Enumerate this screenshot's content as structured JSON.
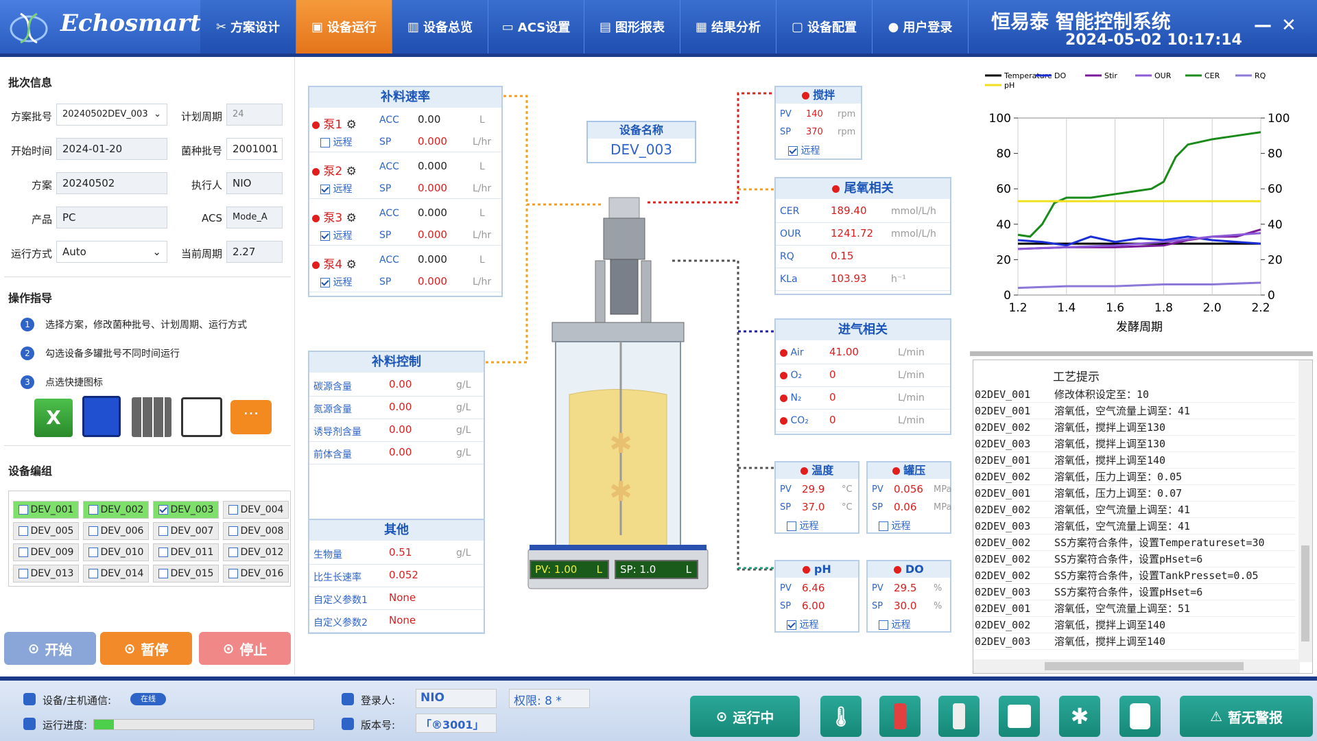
{
  "brand": {
    "logo_text": "Echosmart",
    "system_title": "恒易泰   智能控制系统",
    "datetime": "2024-05-02 10:17:14"
  },
  "nav": [
    {
      "icon": "scissors-icon",
      "label": "方案设计"
    },
    {
      "icon": "device-icon",
      "label": "设备运行"
    },
    {
      "icon": "grid-icon",
      "label": "设备总览"
    },
    {
      "icon": "monitor-icon",
      "label": "ACS设置"
    },
    {
      "icon": "chart-icon",
      "label": "图形报表"
    },
    {
      "icon": "doc-icon",
      "label": "结果分析"
    },
    {
      "icon": "config-icon",
      "label": "设备配置"
    },
    {
      "icon": "user-icon",
      "label": "用户登录"
    }
  ],
  "window": {
    "minimize": "—",
    "close": "✕"
  },
  "batch": {
    "title": "批次信息",
    "scheme_batch_label": "方案批号",
    "scheme_batch": "20240502DEV_003",
    "plan_cycle_label": "计划周期",
    "plan_cycle": "24",
    "start_time_label": "开始时间",
    "start_time": "2024-01-20",
    "strain_batch_label": "菌种批号",
    "strain_batch": "2001001",
    "scheme_label": "方案",
    "scheme": "20240502",
    "executor_label": "执行人",
    "executor": "NIO",
    "product_label": "产品",
    "product": "PC",
    "acs_label": "ACS",
    "acs": "Mode_A",
    "run_mode_label": "运行方式",
    "run_mode": "Auto",
    "current_cycle_label": "当前周期",
    "current_cycle": "2.27"
  },
  "guide": {
    "title": "操作指导",
    "steps": [
      "选择方案，修改菌种批号、计划周期、运行方式",
      "勾选设备多罐批号不同时间运行",
      "点选快捷图标"
    ]
  },
  "devgroup": {
    "title": "设备编组",
    "devices": [
      {
        "name": "DEV_001",
        "checked": false,
        "active": true
      },
      {
        "name": "DEV_002",
        "checked": false,
        "active": true
      },
      {
        "name": "DEV_003",
        "checked": true,
        "active": true
      },
      {
        "name": "DEV_004",
        "checked": false,
        "active": false
      },
      {
        "name": "DEV_005",
        "checked": false,
        "active": false
      },
      {
        "name": "DEV_006",
        "checked": false,
        "active": false
      },
      {
        "name": "DEV_007",
        "checked": false,
        "active": false
      },
      {
        "name": "DEV_008",
        "checked": false,
        "active": false
      },
      {
        "name": "DEV_009",
        "checked": false,
        "active": false
      },
      {
        "name": "DEV_010",
        "checked": false,
        "active": false
      },
      {
        "name": "DEV_011",
        "checked": false,
        "active": false
      },
      {
        "name": "DEV_012",
        "checked": false,
        "active": false
      },
      {
        "name": "DEV_013",
        "checked": false,
        "active": false
      },
      {
        "name": "DEV_014",
        "checked": false,
        "active": false
      },
      {
        "name": "DEV_015",
        "checked": false,
        "active": false
      },
      {
        "name": "DEV_016",
        "checked": false,
        "active": false
      }
    ]
  },
  "actions": {
    "start": "开始",
    "pause": "暂停",
    "stop": "停止"
  },
  "feed_rate": {
    "title": "补料速率",
    "pumps": [
      {
        "name": "泵1",
        "acc": "0.00",
        "acc_unit": "L",
        "sp": "0.000",
        "sp_unit": "L/hr",
        "remote": false
      },
      {
        "name": "泵2",
        "acc": "0.000",
        "acc_unit": "L",
        "sp": "0.000",
        "sp_unit": "L/hr",
        "remote": true
      },
      {
        "name": "泵3",
        "acc": "0.000",
        "acc_unit": "L",
        "sp": "0.000",
        "sp_unit": "L/hr",
        "remote": true
      },
      {
        "name": "泵4",
        "acc": "0.000",
        "acc_unit": "L",
        "sp": "0.000",
        "sp_unit": "L/hr",
        "remote": true
      }
    ],
    "acc_label": "ACC",
    "sp_label": "SP",
    "remote_label": "远程"
  },
  "feed_ctrl": {
    "title": "补料控制",
    "rows": [
      {
        "label": "碳源含量",
        "value": "0.00",
        "unit": "g/L"
      },
      {
        "label": "氮源含量",
        "value": "0.00",
        "unit": "g/L"
      },
      {
        "label": "诱导剂含量",
        "value": "0.00",
        "unit": "g/L"
      },
      {
        "label": "前体含量",
        "value": "0.00",
        "unit": "g/L"
      }
    ]
  },
  "other": {
    "title": "其他",
    "rows": [
      {
        "label": "生物量",
        "value": "0.51",
        "unit": "g/L"
      },
      {
        "label": "比生长速率",
        "value": "0.052",
        "unit": ""
      },
      {
        "label": "自定义参数1",
        "value": "None",
        "unit": ""
      },
      {
        "label": "自定义参数2",
        "value": "None",
        "unit": ""
      }
    ]
  },
  "device_name": {
    "label": "设备名称",
    "value": "DEV_003"
  },
  "reactor": {
    "pv_label": "PV:",
    "pv": "1.00",
    "pv_unit": "L",
    "sp_label": "SP:",
    "sp": "1.0",
    "sp_unit": "L"
  },
  "stir": {
    "title": "搅拌",
    "pv_label": "PV",
    "pv": "140",
    "pv_unit": "rpm",
    "sp_label": "SP",
    "sp": "370",
    "sp_unit": "rpm",
    "remote_label": "远程",
    "remote": true
  },
  "tail_gas": {
    "title": "尾氧相关",
    "rows": [
      {
        "label": "CER",
        "value": "189.40",
        "unit": "mmol/L/h"
      },
      {
        "label": "OUR",
        "value": "1241.72",
        "unit": "mmol/L/h"
      },
      {
        "label": "RQ",
        "value": "0.15",
        "unit": ""
      },
      {
        "label": "KLa",
        "value": "103.93",
        "unit": "h⁻¹"
      }
    ]
  },
  "intake": {
    "title": "进气相关",
    "rows": [
      {
        "label": "Air",
        "value": "41.00",
        "unit": "L/min"
      },
      {
        "label": "O₂",
        "value": "0",
        "unit": "L/min"
      },
      {
        "label": "N₂",
        "value": "0",
        "unit": "L/min"
      },
      {
        "label": "CO₂",
        "value": "0",
        "unit": "L/min"
      }
    ]
  },
  "temp": {
    "title": "温度",
    "pv": "29.9",
    "sp": "37.0",
    "unit": "°C",
    "remote_label": "远程",
    "remote": false
  },
  "pressure": {
    "title": "罐压",
    "pv": "0.056",
    "sp": "0.06",
    "unit": "MPa",
    "remote_label": "远程",
    "remote": false
  },
  "ph": {
    "title": "pH",
    "pv": "6.46",
    "sp": "6.00",
    "unit": "",
    "remote_label": "远程",
    "remote": true
  },
  "do": {
    "title": "DO",
    "pv": "29.5",
    "sp": "30.0",
    "unit": "%",
    "remote_label": "远程",
    "remote": false
  },
  "colors": {
    "Temperature": "#000000",
    "DO": "#1a2ed8",
    "Stir": "#7a1a9a",
    "OUR": "#8c5ad8",
    "CER": "#1a8a1a",
    "RQ": "#8c78d8",
    "pH": "#f0e020"
  },
  "chart_data": {
    "type": "line",
    "legend": [
      "Temperature",
      "DO",
      "Stir",
      "OUR",
      "CER",
      "RQ",
      "pH"
    ],
    "xlabel": "发酵周期",
    "xlim": [
      1.2,
      2.2
    ],
    "ylim": [
      0,
      100
    ],
    "y2lim": [
      0,
      100
    ],
    "xticks": [
      "1.2",
      "1.4",
      "1.6",
      "1.8",
      "2.0",
      "2.2"
    ],
    "yticks": [
      "0",
      "20",
      "40",
      "60",
      "80",
      "100"
    ],
    "y2ticks": [
      "0",
      "20",
      "40",
      "60",
      "80",
      "100"
    ],
    "series": [
      {
        "name": "Temperature",
        "x": [
          1.2,
          1.4,
          1.6,
          1.8,
          2.0,
          2.2
        ],
        "y": [
          29,
          29,
          29,
          29,
          29,
          29
        ]
      },
      {
        "name": "DO",
        "x": [
          1.2,
          1.3,
          1.4,
          1.5,
          1.6,
          1.7,
          1.8,
          1.9,
          2.0,
          2.1,
          2.2
        ],
        "y": [
          31,
          30,
          28,
          33,
          30,
          32,
          31,
          33,
          31,
          30,
          29
        ]
      },
      {
        "name": "Stir",
        "x": [
          1.2,
          1.4,
          1.6,
          1.8,
          1.9,
          2.0,
          2.1,
          2.2
        ],
        "y": [
          26,
          27,
          27,
          28,
          31,
          33,
          33,
          37
        ]
      },
      {
        "name": "OUR",
        "x": [
          1.2,
          1.4,
          1.6,
          1.8,
          2.0,
          2.2
        ],
        "y": [
          26,
          27,
          28,
          30,
          33,
          35
        ]
      },
      {
        "name": "CER",
        "x": [
          1.2,
          1.25,
          1.3,
          1.35,
          1.4,
          1.5,
          1.6,
          1.7,
          1.75,
          1.8,
          1.85,
          1.9,
          2.0,
          2.1,
          2.2
        ],
        "y": [
          34,
          33,
          40,
          52,
          55,
          55,
          57,
          59,
          60,
          64,
          78,
          85,
          88,
          90,
          92
        ]
      },
      {
        "name": "RQ",
        "x": [
          1.2,
          1.4,
          1.6,
          1.8,
          2.0,
          2.2
        ],
        "y": [
          4,
          5,
          5,
          6,
          6,
          7
        ]
      },
      {
        "name": "pH",
        "x": [
          1.2,
          1.4,
          1.6,
          1.8,
          2.0,
          2.2
        ],
        "y": [
          53,
          53,
          53,
          53,
          53,
          53
        ]
      }
    ]
  },
  "log": {
    "header": "工艺提示",
    "rows": [
      {
        "dev": "02DEV_001",
        "msg": "修改体积设定至：10"
      },
      {
        "dev": "02DEV_001",
        "msg": "溶氧低，空气流量上调至：41"
      },
      {
        "dev": "02DEV_002",
        "msg": "溶氧低，搅拌上调至130"
      },
      {
        "dev": "02DEV_003",
        "msg": "溶氧低，搅拌上调至130"
      },
      {
        "dev": "02DEV_001",
        "msg": "溶氧低，搅拌上调至140"
      },
      {
        "dev": "02DEV_002",
        "msg": "溶氧低，压力上调至：0.05"
      },
      {
        "dev": "02DEV_001",
        "msg": "溶氧低，压力上调至：0.07"
      },
      {
        "dev": "02DEV_002",
        "msg": "溶氧低，空气流量上调至：41"
      },
      {
        "dev": "02DEV_003",
        "msg": "溶氧低，空气流量上调至：41"
      },
      {
        "dev": "02DEV_002",
        "msg": "SS方案符合条件，设置Temperatureset=30"
      },
      {
        "dev": "02DEV_002",
        "msg": "SS方案符合条件，设置pHset=6"
      },
      {
        "dev": "02DEV_002",
        "msg": "SS方案符合条件，设置TankPresset=0.05"
      },
      {
        "dev": "02DEV_003",
        "msg": "SS方案符合条件，设置pHset=6"
      },
      {
        "dev": "02DEV_001",
        "msg": "溶氧低，空气流量上调至：51"
      },
      {
        "dev": "02DEV_002",
        "msg": "溶氧低，搅拌上调至140"
      },
      {
        "dev": "02DEV_003",
        "msg": "溶氧低，搅拌上调至140"
      }
    ]
  },
  "status": {
    "comm_label": "设备/主机通信:",
    "comm_badge": "在线",
    "progress_label": "运行进度:",
    "progress": 0.09,
    "login_label": "登录人:",
    "login": "NIO",
    "perm_label": "权限:",
    "perm": "8 *",
    "version_label": "版本号:",
    "version": "「®3001」",
    "running": "运行中",
    "alarm": "暂无警报"
  }
}
